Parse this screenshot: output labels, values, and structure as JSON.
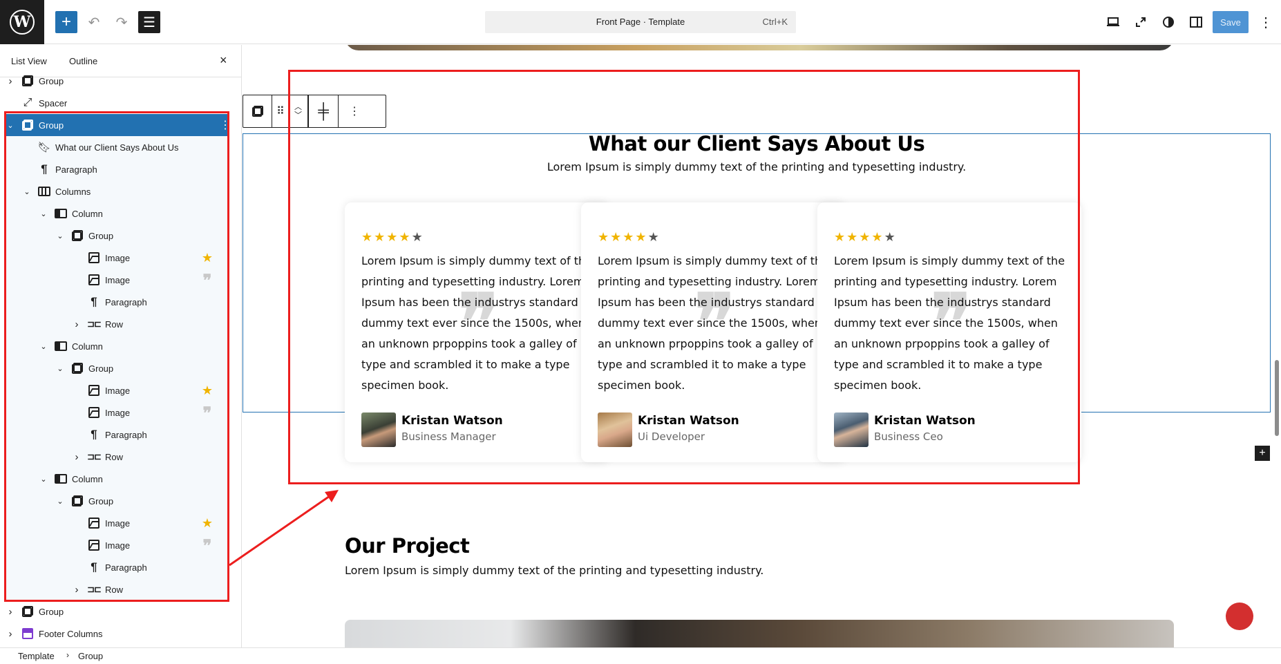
{
  "topbar": {
    "command_title": "Front Page · Template",
    "command_shortcut": "Ctrl+K",
    "save_label": "Save",
    "icons": {
      "add": "plus-icon",
      "undo": "undo-icon",
      "redo": "redo-icon",
      "list_view": "list-view-icon",
      "device": "desktop-icon",
      "expand": "external-icon",
      "styles": "contrast-icon",
      "settings": "sidebar-toggle-icon",
      "options": "more-vertical-icon"
    }
  },
  "sidebar": {
    "tabs": [
      "List View",
      "Outline"
    ],
    "close": "×",
    "tree": [
      {
        "label": "Group",
        "icon": "group-icon",
        "expanded": false
      },
      {
        "label": "Spacer",
        "icon": "spacer-icon"
      },
      {
        "label": "Group",
        "icon": "group-icon",
        "expanded": true,
        "selected": true
      },
      {
        "label": "What our Client Says About Us",
        "icon": "heading-icon"
      },
      {
        "label": "Paragraph",
        "icon": "paragraph-icon"
      },
      {
        "label": "Columns",
        "icon": "columns-icon",
        "expanded": true
      },
      {
        "label": "Column",
        "icon": "column-icon",
        "expanded": true
      },
      {
        "label": "Group",
        "icon": "group-icon",
        "expanded": true
      },
      {
        "label": "Image",
        "icon": "image-icon",
        "badge": "star-icon"
      },
      {
        "label": "Image",
        "icon": "image-icon",
        "badge": "quote-icon"
      },
      {
        "label": "Paragraph",
        "icon": "paragraph-icon"
      },
      {
        "label": "Row",
        "icon": "row-icon",
        "expanded": false
      },
      {
        "label": "Column",
        "icon": "column-icon",
        "expanded": true
      },
      {
        "label": "Group",
        "icon": "group-icon",
        "expanded": true
      },
      {
        "label": "Image",
        "icon": "image-icon",
        "badge": "star-icon"
      },
      {
        "label": "Image",
        "icon": "image-icon",
        "badge": "quote-icon"
      },
      {
        "label": "Paragraph",
        "icon": "paragraph-icon"
      },
      {
        "label": "Row",
        "icon": "row-icon",
        "expanded": false
      },
      {
        "label": "Column",
        "icon": "column-icon",
        "expanded": true
      },
      {
        "label": "Group",
        "icon": "group-icon",
        "expanded": true
      },
      {
        "label": "Image",
        "icon": "image-icon",
        "badge": "star-icon"
      },
      {
        "label": "Image",
        "icon": "image-icon",
        "badge": "quote-icon"
      },
      {
        "label": "Paragraph",
        "icon": "paragraph-icon"
      },
      {
        "label": "Row",
        "icon": "row-icon",
        "expanded": false
      },
      {
        "label": "Group",
        "icon": "group-icon",
        "expanded": false
      },
      {
        "label": "Footer Columns",
        "icon": "template-part-icon",
        "expanded": false
      }
    ]
  },
  "breadcrumb": {
    "items": [
      "Template",
      "Group"
    ],
    "separator": "›"
  },
  "canvas": {
    "testimonials": {
      "heading": "What our Client Says About Us",
      "subheading": "Lorem Ipsum is simply dummy text of the printing and typesetting industry.",
      "cards": [
        {
          "rating": 4,
          "review": "Lorem Ipsum is simply dummy text of the printing and typesetting industry. Lorem Ipsum has been the industrys standard dummy text ever since the 1500s, when an unknown prpoppins took a galley of type and scrambled it to make a type specimen book.",
          "name": "Kristan Watson",
          "role": "Business Manager"
        },
        {
          "rating": 4,
          "review": "Lorem Ipsum is simply dummy text of the printing and typesetting industry. Lorem Ipsum has been the industrys standard dummy text ever since the 1500s, when an unknown prpoppins took a galley of type and scrambled it to make a type specimen book.",
          "name": "Kristan Watson",
          "role": "Ui Developer"
        },
        {
          "rating": 4,
          "review": "Lorem Ipsum is simply dummy text of the printing and typesetting industry. Lorem Ipsum has been the industrys standard dummy text ever since the 1500s, when an unknown prpoppins took a galley of type and scrambled it to make a type specimen book.",
          "name": "Kristan Watson",
          "role": "Business Ceo"
        }
      ]
    },
    "project": {
      "heading": "Our Project",
      "subheading": "Lorem Ipsum is simply dummy text of the printing and typesetting industry."
    }
  },
  "colors": {
    "accent": "#2271b1",
    "annotation": "#ec1e1e",
    "star": "#f0b400"
  }
}
